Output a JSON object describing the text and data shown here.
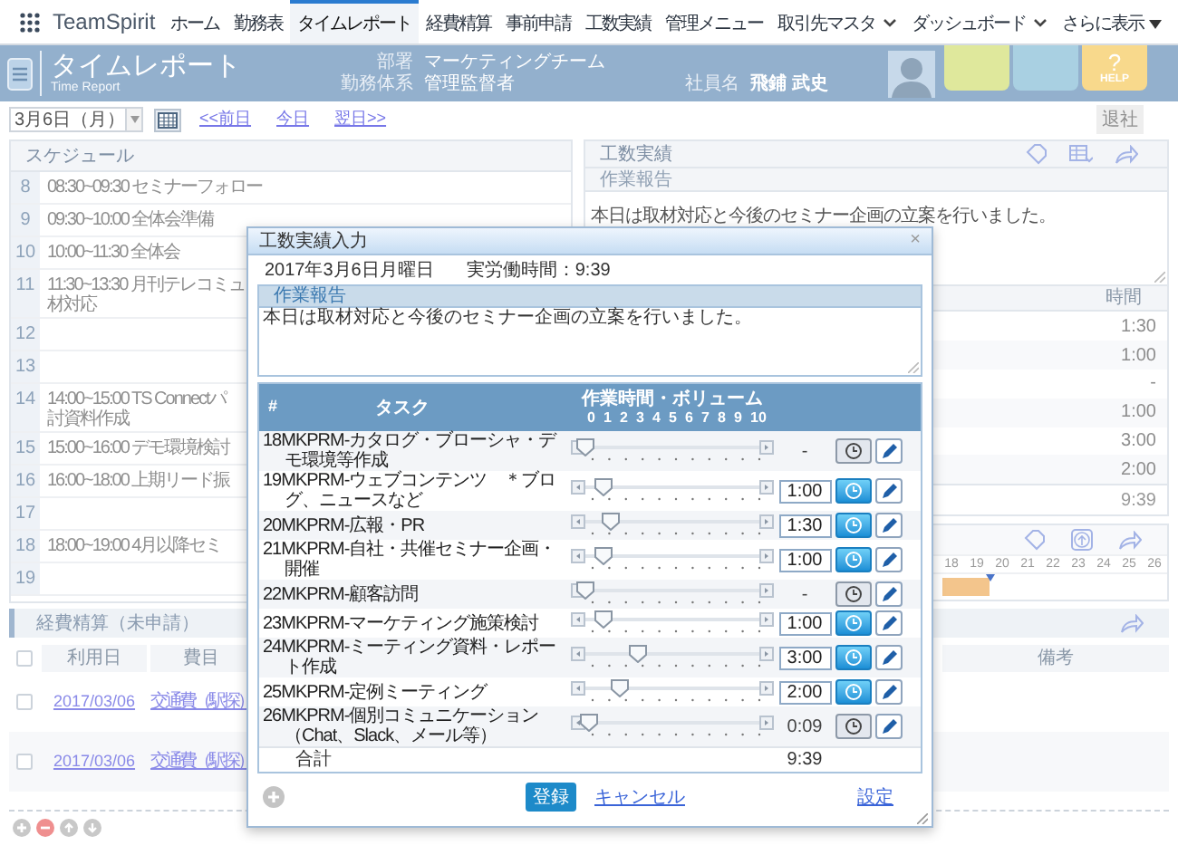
{
  "nav": {
    "app_name": "TeamSpirit",
    "tabs": [
      {
        "label": "ホーム",
        "kind": "plain",
        "selected": false
      },
      {
        "label": "勤務表",
        "kind": "plain",
        "selected": false
      },
      {
        "label": "タイムレポート",
        "kind": "plain",
        "selected": true
      },
      {
        "label": "経費精算",
        "kind": "plain",
        "selected": false
      },
      {
        "label": "事前申請",
        "kind": "plain",
        "selected": false
      },
      {
        "label": "工数実績",
        "kind": "plain",
        "selected": false
      },
      {
        "label": "管理メニュー",
        "kind": "plain",
        "selected": false
      },
      {
        "label": "取引先マスタ",
        "kind": "dropdown",
        "selected": false
      },
      {
        "label": "ダッシュボード",
        "kind": "dropdown",
        "selected": false
      },
      {
        "label": "さらに表示",
        "kind": "more",
        "selected": false
      }
    ]
  },
  "header": {
    "title": "タイムレポート",
    "subtitle": "Time Report",
    "department": {
      "label": "部署",
      "value": "マーケティングチーム"
    },
    "work_type": {
      "label": "勤務体系",
      "value": "管理監督者"
    },
    "employee": {
      "label": "社員名",
      "value": "飛鋪 武史"
    },
    "tiles": [
      {
        "color": "#dfe89c"
      },
      {
        "color": "#a9d0e2"
      },
      {
        "color": "#f8d98c",
        "symbol": "?",
        "label": "HELP"
      }
    ]
  },
  "toolbar": {
    "date": "3月6日（月）",
    "prev": "<<前日",
    "today": "今日",
    "next": "翌日>>",
    "leave_button": {
      "label": "退社",
      "disabled": true
    }
  },
  "schedule": {
    "title": "スケジュール",
    "rows": [
      {
        "hour": "8",
        "lines": [
          "08:30~09:30 セミナーフォロー"
        ]
      },
      {
        "hour": "9",
        "lines": [
          "09:30~10:00 全体会準備"
        ]
      },
      {
        "hour": "10",
        "lines": [
          "10:00~11:30 全体会"
        ]
      },
      {
        "hour": "11",
        "lines": [
          "11:30~13:30 月刊テレコミュ",
          "材対応"
        ]
      },
      {
        "hour": "12",
        "lines": []
      },
      {
        "hour": "13",
        "lines": []
      },
      {
        "hour": "14",
        "lines": [
          "14:00~15:00 TS Connectパ",
          "討資料作成"
        ]
      },
      {
        "hour": "15",
        "lines": [
          "15:00~16:00 デモ環境検討"
        ]
      },
      {
        "hour": "16",
        "lines": [
          "16:00~18:00 上期リード振"
        ]
      },
      {
        "hour": "17",
        "lines": []
      },
      {
        "hour": "18",
        "lines": [
          "18:00~19:00 4月以降セミ"
        ]
      },
      {
        "hour": "19",
        "lines": []
      }
    ]
  },
  "work_panel": {
    "title": "工数実績",
    "report_label": "作業報告",
    "report": "本日は取材対応と今後のセミナー企画の立案を行いました。",
    "time_header": "時間",
    "times": [
      "1:30",
      "1:00",
      "-",
      "1:00",
      "3:00",
      "2:00"
    ],
    "total": "9:39"
  },
  "calendar_panel": {
    "days": [
      "18",
      "19",
      "20",
      "21",
      "22",
      "23",
      "24",
      "25",
      "26"
    ]
  },
  "expenses": {
    "title": "経費精算（未申請）",
    "all_checked": false,
    "columns": [
      "利用日",
      "費目",
      "備考"
    ],
    "rows": [
      {
        "checked": false,
        "date": "2017/03/06",
        "item": "交通費（駅探）"
      },
      {
        "checked": false,
        "date": "2017/03/06",
        "item": "交通費（駅探）"
      }
    ]
  },
  "dialog": {
    "title": "工数実績入力",
    "close": "×",
    "date": "2017年3月6日月曜日",
    "work_time": "実労働時間：9:39",
    "report_label": "作業報告",
    "report": "本日は取材対応と今後のセミナー企画の立案を行いました。",
    "columns": {
      "num": "#",
      "task": "タスク",
      "volume": "作業時間・ボリューム"
    },
    "scale": [
      "0",
      "1",
      "2",
      "3",
      "4",
      "5",
      "6",
      "7",
      "8",
      "9",
      "10"
    ],
    "tasks": [
      {
        "name": "18MKPRM-カタログ・ブローシャ・デモ環境等作成",
        "level": 0.0,
        "kind": "text",
        "time": "-",
        "timer_on": false
      },
      {
        "name": "19MKPRM-ウェブコンテンツ　＊ブログ、ニュースなど",
        "level": 0.1,
        "kind": "input",
        "time": "1:00",
        "timer_on": true
      },
      {
        "name": "20MKPRM-広報・PR",
        "level": 0.15,
        "kind": "input",
        "time": "1:30",
        "timer_on": true
      },
      {
        "name": "21MKPRM-自社・共催セミナー企画・開催",
        "level": 0.1,
        "kind": "input",
        "time": "1:00",
        "timer_on": true
      },
      {
        "name": "22MKPRM-顧客訪問",
        "level": 0.0,
        "kind": "text",
        "time": "-",
        "timer_on": false
      },
      {
        "name": "23MKPRM-マーケティング施策検討",
        "level": 0.1,
        "kind": "input",
        "time": "1:00",
        "timer_on": true
      },
      {
        "name": "24MKPRM-ミーティング資料・レポート作成",
        "level": 0.3,
        "kind": "input",
        "time": "3:00",
        "timer_on": true
      },
      {
        "name": "25MKPRM-定例ミーティング",
        "level": 0.2,
        "kind": "input",
        "time": "2:00",
        "timer_on": true
      },
      {
        "name": "26MKPRM-個別コミュニケーション（Chat、Slack、メール等）",
        "level": 0.02,
        "kind": "text",
        "time": "0:09",
        "timer_on": false
      }
    ],
    "total_label": "合計",
    "total": "9:39",
    "submit": "登録",
    "cancel": "キャンセル",
    "settings": "設定"
  }
}
